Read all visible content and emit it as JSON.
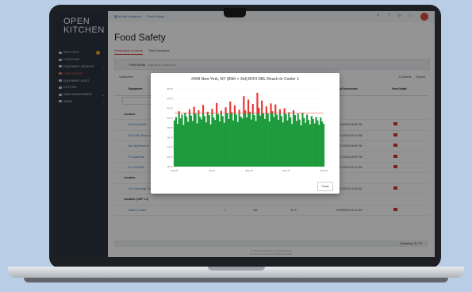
{
  "app": {
    "logo_line1": "OPEN",
    "logo_line2": "KITCHEN"
  },
  "sidebar": {
    "items": [
      {
        "label": "SPOTLIGHT",
        "active": false
      },
      {
        "label": "LOCATIONS",
        "active": false
      },
      {
        "label": "EQUIPMENT INSIGHTS",
        "active": false
      },
      {
        "label": "FOOD SAFETY",
        "active": true
      },
      {
        "label": "EQUIPMENT ALERT",
        "active": false
      },
      {
        "label": "UTILITIES",
        "active": false
      },
      {
        "label": "MENU MANAGEMENT",
        "active": false
      },
      {
        "label": "ADMIN",
        "active": false
      }
    ]
  },
  "topbar": {
    "breadcrumb_1": "All My Locations",
    "breadcrumb_2": "Food Safety"
  },
  "page": {
    "title": "Food Safety",
    "tabs": [
      "Temperature Incidents",
      "Task Exceptions"
    ],
    "filter_label": "Past Month",
    "filter_range": "( 2023-08-26 - 2023-09-16 )",
    "toolbar_left": "Subscribe",
    "toolbar_right": [
      "Columns",
      "Export"
    ],
    "columns": [
      "Equipment",
      "Last Occurrence",
      "View Graph"
    ],
    "rows": [
      {
        "type": "location",
        "name": "Location:"
      },
      {
        "type": "item",
        "name": "DLS Cold Well",
        "date": "09/16/2023 06:28 PM"
      },
      {
        "type": "item",
        "name": "BOH DBL Reach-In",
        "date": "09/17/2023 09:13 PM"
      },
      {
        "type": "item",
        "name": "Bar Sgl Reach-In",
        "date": "09/17/2023 08:55 PM"
      },
      {
        "type": "item",
        "name": "FL Salad Bar",
        "date": "09/17/2023 05:05 PM"
      },
      {
        "type": "item",
        "name": "FL Cold Well",
        "date": "09/17/2023 03:21 AM"
      },
      {
        "type": "location",
        "name": "Location:"
      },
      {
        "type": "item",
        "name": "Cul1 Beverage Cold Well",
        "c2": "1",
        "c3": "452",
        "c4": "57 °F",
        "date": "09/17/2023 12:06 AM"
      },
      {
        "type": "location",
        "name": "Location: (DSF 1-2)"
      },
      {
        "type": "item",
        "name": "Walk-In Cooler",
        "c2": "1",
        "c3": "489",
        "c4": "45 °F",
        "date": "09/09/2023 01:21 AM"
      }
    ],
    "displaying": "Displaying: 32 / 32",
    "legal_line1": "© 2023 Open Kitchen Inc. All rights reserved.",
    "legal_line2": "The Terms of Service and Privacy Policy apply."
  },
  "modal": {
    "title": "#049 New York, NY (85th + 3rd) BOH DBL Reach-In Cooler 1",
    "close_label": "Close"
  },
  "chart_data": {
    "type": "area",
    "ylim": [
      30,
      46
    ],
    "threshold": 41,
    "threshold_color": "#e53935",
    "below_color": "#1e9b3c",
    "above_color": "#e53935",
    "x_ticks": [
      "Aug 27",
      "Sep 3",
      "Sep 10",
      "Sep 17",
      "Sep 24"
    ],
    "y_ticks": [
      30,
      32,
      34,
      36,
      38,
      40,
      42,
      44,
      46
    ],
    "y_tick_suffix": " °F",
    "x_range": [
      0,
      100
    ],
    "samples": [
      39.5,
      40.2,
      38.8,
      41.4,
      39.9,
      40.7,
      38.6,
      41.1,
      40.3,
      39.2,
      41.8,
      40.5,
      39.4,
      42.3,
      40.9,
      38.9,
      41.6,
      40.2,
      39.7,
      42.7,
      40.4,
      39.1,
      41.3,
      40.6,
      38.7,
      41.9,
      40.1,
      39.6,
      43.1,
      40.8,
      39.3,
      41.5,
      40.4,
      39.0,
      42.2,
      41.0,
      39.8,
      43.4,
      41.2,
      39.5,
      42.6,
      40.7,
      39.2,
      41.7,
      40.3,
      39.9,
      44.5,
      41.6,
      40.1,
      43.8,
      41.3,
      39.7,
      42.9,
      40.6,
      39.4,
      45.2,
      42.1,
      40.5,
      43.6,
      41.0,
      39.8,
      42.4,
      40.9,
      39.3,
      43.0,
      41.4,
      40.2,
      42.8,
      40.7,
      39.6,
      41.8,
      40.4,
      39.1,
      42.0,
      40.8,
      39.5,
      41.2,
      40.1,
      38.8,
      41.6,
      40.6,
      39.4,
      40.9,
      39.7,
      38.5,
      41.1,
      40.0,
      39.0,
      40.7,
      39.6,
      38.7,
      40.4,
      39.8,
      38.9,
      40.2,
      39.5,
      38.6,
      40.1,
      39.3,
      38.8
    ]
  }
}
